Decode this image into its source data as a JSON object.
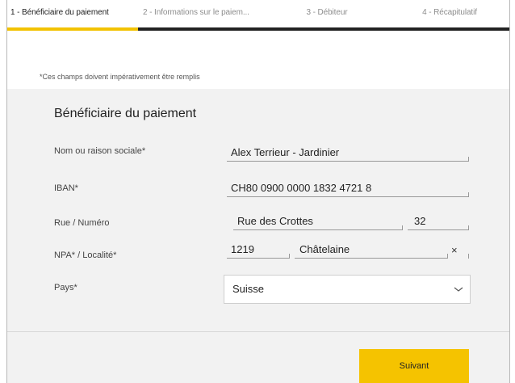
{
  "tabs": [
    {
      "label": "1 - Bénéficiaire du paiement",
      "active": true
    },
    {
      "label": "2 - Informations sur le paiem...",
      "active": false
    },
    {
      "label": "3 - Débiteur",
      "active": false
    },
    {
      "label": "4 - Récapitulatif",
      "active": false
    }
  ],
  "required_note": "*Ces champs doivent impérativement être remplis",
  "section_title": "Bénéficiaire du paiement",
  "form": {
    "name_label": "Nom ou raison sociale*",
    "name_value": "Alex Terrieur - Jardinier",
    "iban_label": "IBAN*",
    "iban_value": "CH80 0900 0000 1832 4721 8",
    "street_label": "Rue / Numéro",
    "street_value": "Rue des Crottes",
    "number_value": "32",
    "npa_label": "NPA* / Localité*",
    "npa_value": "1219",
    "city_value": "Châtelaine",
    "clear_symbol": "×",
    "country_label": "Pays*",
    "country_value": "Suisse"
  },
  "buttons": {
    "next_label": "Suivant"
  },
  "colors": {
    "accent": "#f5c300",
    "panel": "#f2f2f2",
    "tab_bar": "#222222"
  }
}
